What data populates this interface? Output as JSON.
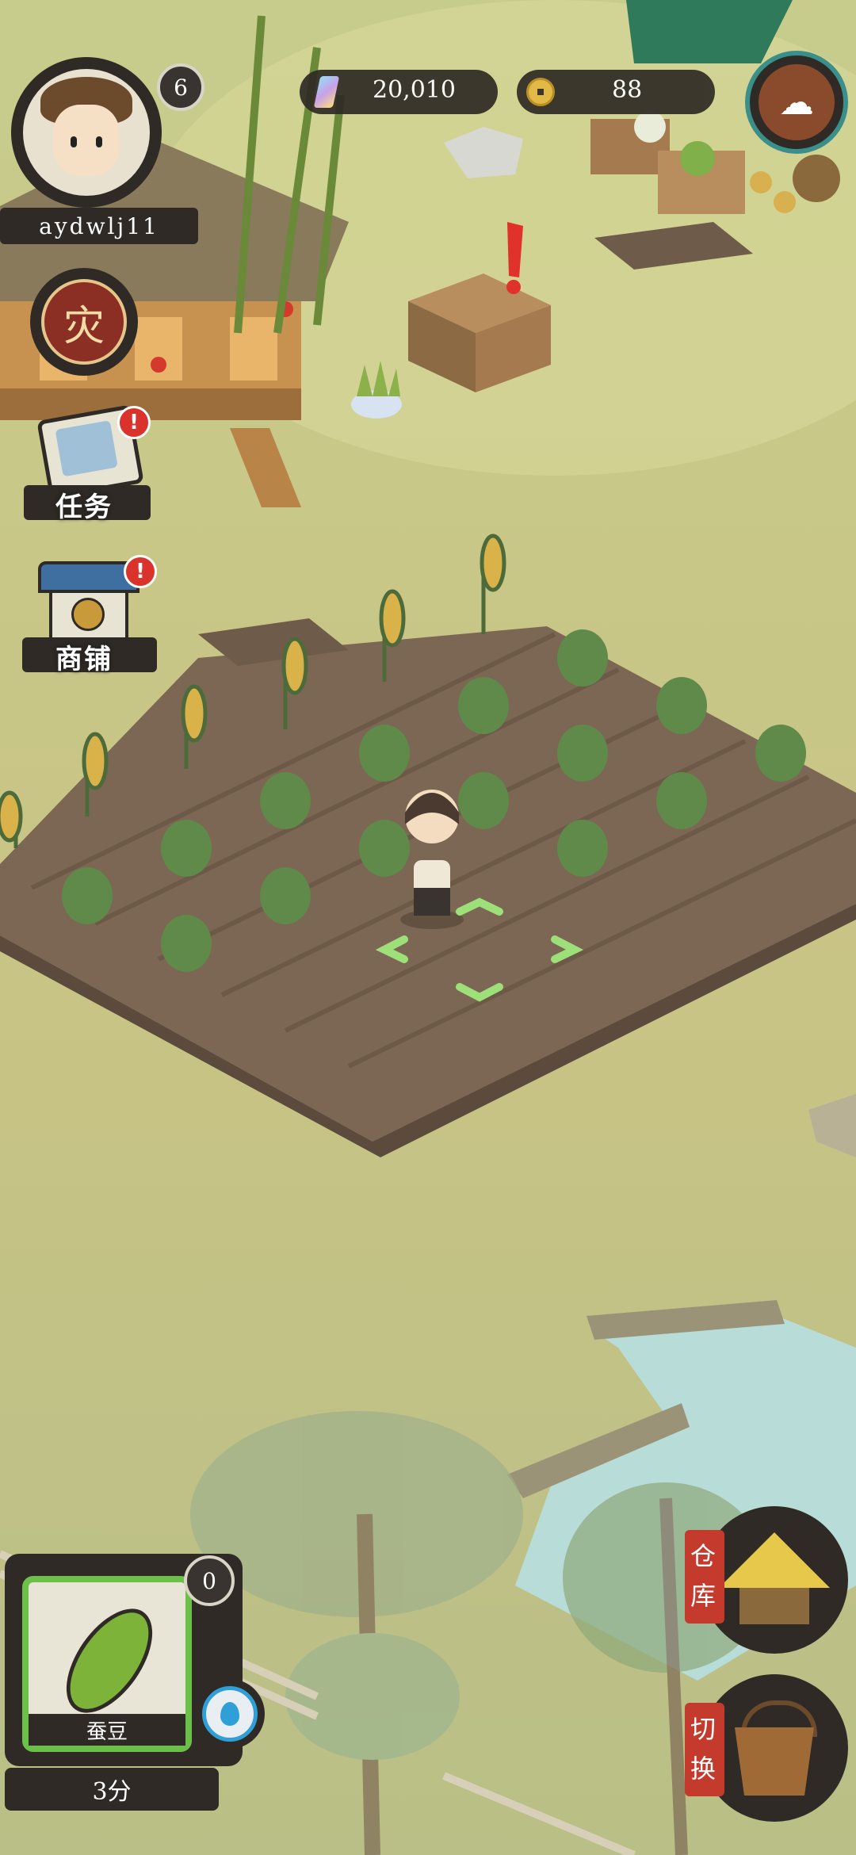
{
  "player": {
    "name": "aydwlj11",
    "level": "6"
  },
  "currency": {
    "crystals": "20,010",
    "coins": "88"
  },
  "menu": {
    "disaster_char": "灾",
    "tasks_label": "任务",
    "shop_label": "商铺"
  },
  "seed_panel": {
    "count": "0",
    "seed_name": "蚕豆",
    "time_label": "3分"
  },
  "right_buttons": {
    "warehouse_label": "仓库",
    "switch_label": "切换"
  },
  "colors": {
    "grass": "#c9c78a",
    "soil": "#7a6552",
    "hud_dark": "#2f2a25",
    "accent_green": "#6cc04a",
    "alert_red": "#d9332b"
  }
}
